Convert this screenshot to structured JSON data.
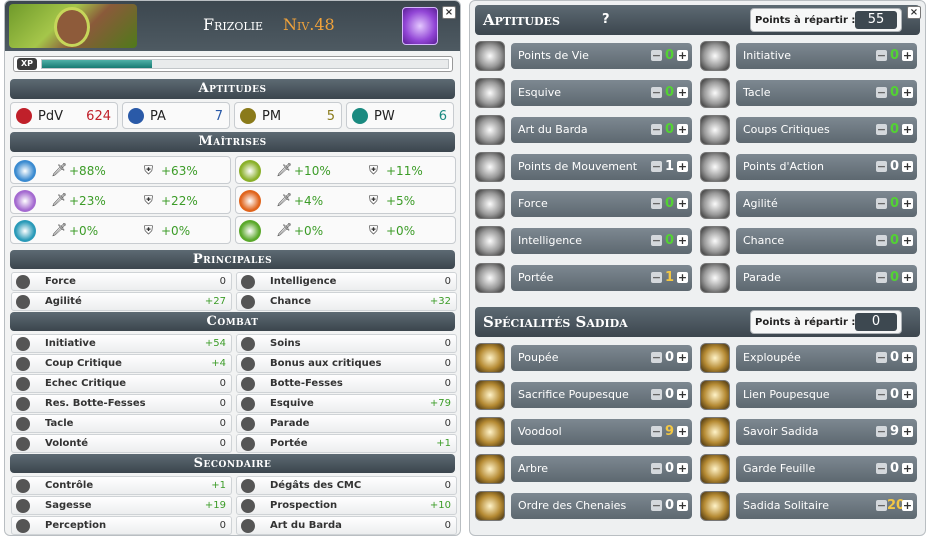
{
  "character": {
    "name": "Frizolie",
    "level": "Niv.48",
    "xp_label": "XP",
    "xp_fraction": 0.27
  },
  "left": {
    "aptitudes_title": "Aptitudes",
    "vitals": [
      {
        "icon": "heart-icon",
        "label": "PdV",
        "value": "624",
        "color": "#c0202a"
      },
      {
        "icon": "star-icon",
        "label": "PA",
        "value": "7",
        "color": "#2a5aa8"
      },
      {
        "icon": "footprint-icon",
        "label": "PM",
        "value": "5",
        "color": "#8a7a1a"
      },
      {
        "icon": "wakfu-icon",
        "label": "PW",
        "value": "6",
        "color": "#1a8a80"
      }
    ],
    "maitrises_title": "Maîtrises",
    "maitrises": [
      {
        "element": "water",
        "icon": "water-element-icon",
        "color": "#3b8bd0",
        "damage": "+88%",
        "resist": "+63%"
      },
      {
        "element": "earth",
        "icon": "earth-element-icon",
        "color": "#8ab02a",
        "damage": "+10%",
        "resist": "+11%"
      },
      {
        "element": "air",
        "icon": "air-element-icon",
        "color": "#a46ad0",
        "damage": "+23%",
        "resist": "+22%"
      },
      {
        "element": "fire",
        "icon": "fire-element-icon",
        "color": "#e0641c",
        "damage": "+4%",
        "resist": "+5%"
      },
      {
        "element": "stasis",
        "icon": "star-element-icon",
        "color": "#2a9ab8",
        "damage": "+0%",
        "resist": "+0%"
      },
      {
        "element": "nature",
        "icon": "leaf-element-icon",
        "color": "#5aa82a",
        "damage": "+0%",
        "resist": "+0%"
      }
    ],
    "principales_title": "Principales",
    "principales": [
      {
        "icon": "fist-icon",
        "label": "Force",
        "value": "0",
        "positive": false
      },
      {
        "icon": "brain-icon",
        "label": "Intelligence",
        "value": "0",
        "positive": false
      },
      {
        "icon": "running-icon",
        "label": "Agilité",
        "value": "+27",
        "positive": true
      },
      {
        "icon": "clover-icon",
        "label": "Chance",
        "value": "+32",
        "positive": true
      }
    ],
    "combat_title": "Combat",
    "combat": [
      {
        "icon": "initiative-icon",
        "label": "Initiative",
        "value": "+54",
        "positive": true
      },
      {
        "icon": "heal-icon",
        "label": "Soins",
        "value": "0",
        "positive": false
      },
      {
        "icon": "claw-icon",
        "label": "Coup Critique",
        "value": "+4",
        "positive": true
      },
      {
        "icon": "bonus-crit-icon",
        "label": "Bonus aux critiques",
        "value": "0",
        "positive": false
      },
      {
        "icon": "fail-icon",
        "label": "Echec Critique",
        "value": "0",
        "positive": false
      },
      {
        "icon": "backstab-icon",
        "label": "Botte-Fesses",
        "value": "0",
        "positive": false
      },
      {
        "icon": "backstab-resist-icon",
        "label": "Res. Botte-Fesses",
        "value": "0",
        "positive": false
      },
      {
        "icon": "dodge-icon",
        "label": "Esquive",
        "value": "+79",
        "positive": true
      },
      {
        "icon": "tackle-icon",
        "label": "Tacle",
        "value": "0",
        "positive": false
      },
      {
        "icon": "shield-icon",
        "label": "Parade",
        "value": "0",
        "positive": false
      },
      {
        "icon": "lightning-icon",
        "label": "Volonté",
        "value": "0",
        "positive": false
      },
      {
        "icon": "eye-icon",
        "label": "Portée",
        "value": "+1",
        "positive": true
      }
    ],
    "secondaire_title": "Secondaire",
    "secondaire": [
      {
        "icon": "paw-icon",
        "label": "Contrôle",
        "value": "+1",
        "positive": true
      },
      {
        "icon": "skull-icon",
        "label": "Dégâts des CMC",
        "value": "0",
        "positive": false
      },
      {
        "icon": "book-icon",
        "label": "Sagesse",
        "value": "+19",
        "positive": true
      },
      {
        "icon": "prospect-icon",
        "label": "Prospection",
        "value": "+10",
        "positive": true
      },
      {
        "icon": "perception-icon",
        "label": "Perception",
        "value": "0",
        "positive": false
      },
      {
        "icon": "backpack-icon",
        "label": "Art du Barda",
        "value": "0",
        "positive": false
      }
    ]
  },
  "right": {
    "aptitudes_title": "Aptitudes",
    "help_label": "?",
    "points_label": "Points à répartir :",
    "points_value": "55",
    "aptitudes": [
      {
        "icon": "points-de-vie-icon",
        "label": "Points de Vie",
        "value": "0",
        "tone": "zero"
      },
      {
        "icon": "initiative-icon",
        "label": "Initiative",
        "value": "0",
        "tone": "zero"
      },
      {
        "icon": "esquive-icon",
        "label": "Esquive",
        "value": "0",
        "tone": "zero"
      },
      {
        "icon": "tacle-icon",
        "label": "Tacle",
        "value": "0",
        "tone": "zero"
      },
      {
        "icon": "art-du-barda-icon",
        "label": "Art du Barda",
        "value": "0",
        "tone": "zero"
      },
      {
        "icon": "coups-critiques-icon",
        "label": "Coups Critiques",
        "value": "0",
        "tone": "zero"
      },
      {
        "icon": "points-de-mouvement-icon",
        "label": "Points de Mouvement",
        "value": "1",
        "tone": "white"
      },
      {
        "icon": "points-d-action-icon",
        "label": "Points d'Action",
        "value": "0",
        "tone": "white"
      },
      {
        "icon": "force-icon",
        "label": "Force",
        "value": "0",
        "tone": "zero"
      },
      {
        "icon": "agilite-icon",
        "label": "Agilité",
        "value": "0",
        "tone": "zero"
      },
      {
        "icon": "intelligence-icon",
        "label": "Intelligence",
        "value": "0",
        "tone": "zero"
      },
      {
        "icon": "chance-icon",
        "label": "Chance",
        "value": "0",
        "tone": "zero"
      },
      {
        "icon": "portee-icon",
        "label": "Portée",
        "value": "1",
        "tone": "gold"
      },
      {
        "icon": "parade-icon",
        "label": "Parade",
        "value": "0",
        "tone": "zero"
      }
    ],
    "specialites_title": "Spécialités Sadida",
    "spec_points_label": "Points à répartir :",
    "spec_points_value": "0",
    "specialites": [
      {
        "icon": "poupee-icon",
        "label": "Poupée",
        "value": "0",
        "tone": "white"
      },
      {
        "icon": "exploupee-icon",
        "label": "Exploupée",
        "value": "0",
        "tone": "white"
      },
      {
        "icon": "sacrifice-poupesque-icon",
        "label": "Sacrifice Poupesque",
        "value": "0",
        "tone": "white"
      },
      {
        "icon": "lien-poupesque-icon",
        "label": "Lien Poupesque",
        "value": "0",
        "tone": "white"
      },
      {
        "icon": "voodool-icon",
        "label": "Voodool",
        "value": "9",
        "tone": "gold"
      },
      {
        "icon": "savoir-sadida-icon",
        "label": "Savoir Sadida",
        "value": "9",
        "tone": "white"
      },
      {
        "icon": "arbre-icon",
        "label": "Arbre",
        "value": "0",
        "tone": "white"
      },
      {
        "icon": "garde-feuille-icon",
        "label": "Garde Feuille",
        "value": "0",
        "tone": "white"
      },
      {
        "icon": "ordre-des-chenaies-icon",
        "label": "Ordre des Chenaies",
        "value": "0",
        "tone": "white"
      },
      {
        "icon": "sadida-solitaire-icon",
        "label": "Sadida Solitaire",
        "value": "20",
        "tone": "gold"
      }
    ]
  }
}
